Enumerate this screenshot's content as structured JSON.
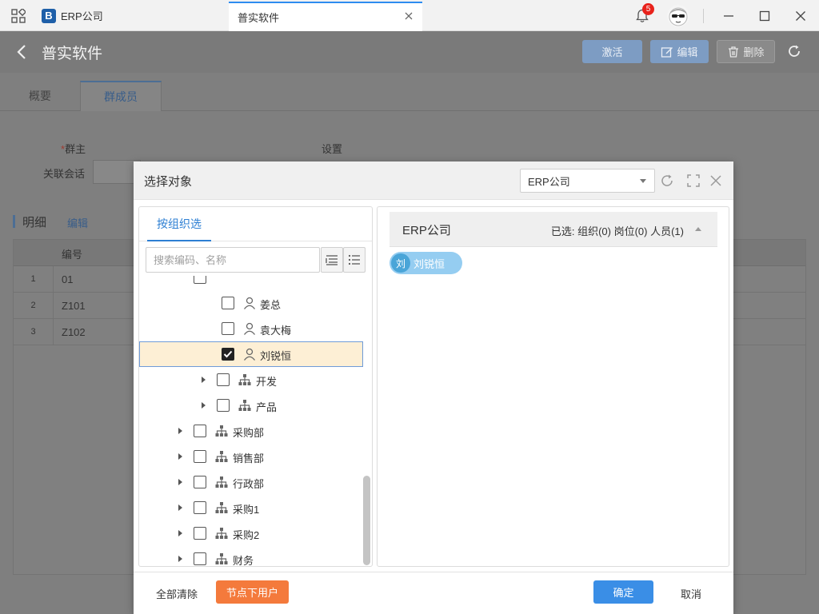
{
  "titlebar": {
    "app_tab_label": "ERP公司",
    "app_logo_letter": "B",
    "active_tab_label": "普实软件",
    "notification_count": "5"
  },
  "header": {
    "title": "普实软件",
    "activate_label": "激活",
    "edit_label": "编辑",
    "delete_label": "删除"
  },
  "tabs": [
    "概要",
    "群成员"
  ],
  "background": {
    "owner_req_mark": "*",
    "owner_label": "群主",
    "settings_label": "设置",
    "linked_chat_label": "关联会话",
    "section_title": "明细",
    "section_edit": "编辑",
    "table_header": "编号",
    "rows": [
      {
        "idx": "1",
        "code": "01"
      },
      {
        "idx": "2",
        "code": "Z101"
      },
      {
        "idx": "3",
        "code": "Z102"
      }
    ]
  },
  "modal": {
    "title": "选择对象",
    "company_select": "ERP公司",
    "left_tab": "按组织选",
    "search_placeholder": "搜索编码、名称",
    "tree": [
      {
        "label": "姜总",
        "type": "user",
        "checked": false
      },
      {
        "label": "袁大梅",
        "type": "user",
        "checked": false
      },
      {
        "label": "刘锐恒",
        "type": "user",
        "checked": true
      },
      {
        "label": "开发",
        "type": "org",
        "checked": false
      },
      {
        "label": "产品",
        "type": "org",
        "checked": false
      },
      {
        "label": "采购部",
        "type": "org",
        "checked": false
      },
      {
        "label": "销售部",
        "type": "org",
        "checked": false
      },
      {
        "label": "行政部",
        "type": "org",
        "checked": false
      },
      {
        "label": "采购1",
        "type": "org",
        "checked": false
      },
      {
        "label": "采购2",
        "type": "org",
        "checked": false
      },
      {
        "label": "财务",
        "type": "org",
        "checked": false
      }
    ],
    "right_org": "ERP公司",
    "selected_summary": "已选: 组织(0) 岗位(0) 人员(1)",
    "chip_initial": "刘",
    "chip_label": "刘锐恒",
    "clear_all": "全部清除",
    "node_users": "节点下用户",
    "ok": "确定",
    "cancel": "取消"
  },
  "colors": {
    "accent": "#2d7fd3",
    "primary_button": "#3a8ee6",
    "orange_button": "#f47a3c",
    "selected_row": "#fdefd5",
    "chip": "#95cdf1"
  }
}
